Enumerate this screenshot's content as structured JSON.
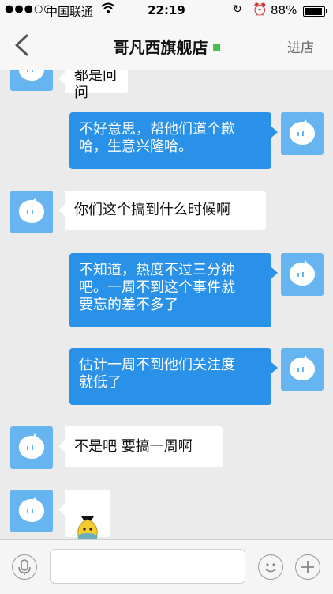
{
  "status_bar": {
    "signal": "●●●○○",
    "carrier": "中国联通",
    "time": "22:19",
    "battery_pct": "88%"
  },
  "header": {
    "title": "哥凡西旗舰店",
    "enter_label": "进店"
  },
  "messages": [
    {
      "side": "in",
      "text": "都是问问"
    },
    {
      "side": "out",
      "text": "不好意思，帮他们道个歉\n哈，生意兴隆哈。"
    },
    {
      "side": "in",
      "text": "你们这个搞到什么时候啊"
    },
    {
      "side": "out",
      "text": "不知道，热度不过三分钟\n吧。一周不到这个事件就\n要忘的差不多了"
    },
    {
      "side": "out",
      "text": "估计一周不到他们关注度\n就低了"
    },
    {
      "side": "in",
      "text": "不是吧 要搞一周啊"
    },
    {
      "side": "in",
      "sticker": "pear-sticker"
    }
  ],
  "input": {
    "placeholder": ""
  },
  "colors": {
    "outgoing_bubble": "#2a91e8",
    "incoming_bubble": "#ffffff",
    "avatar": "#66b5f0",
    "online": "#46c24b"
  },
  "icons": [
    "back-chevron-icon",
    "wifi-icon",
    "rotation-lock-icon",
    "alarm-icon",
    "battery-icon",
    "microphone-icon",
    "emoji-icon",
    "plus-icon",
    "wangwang-avatar-icon"
  ]
}
